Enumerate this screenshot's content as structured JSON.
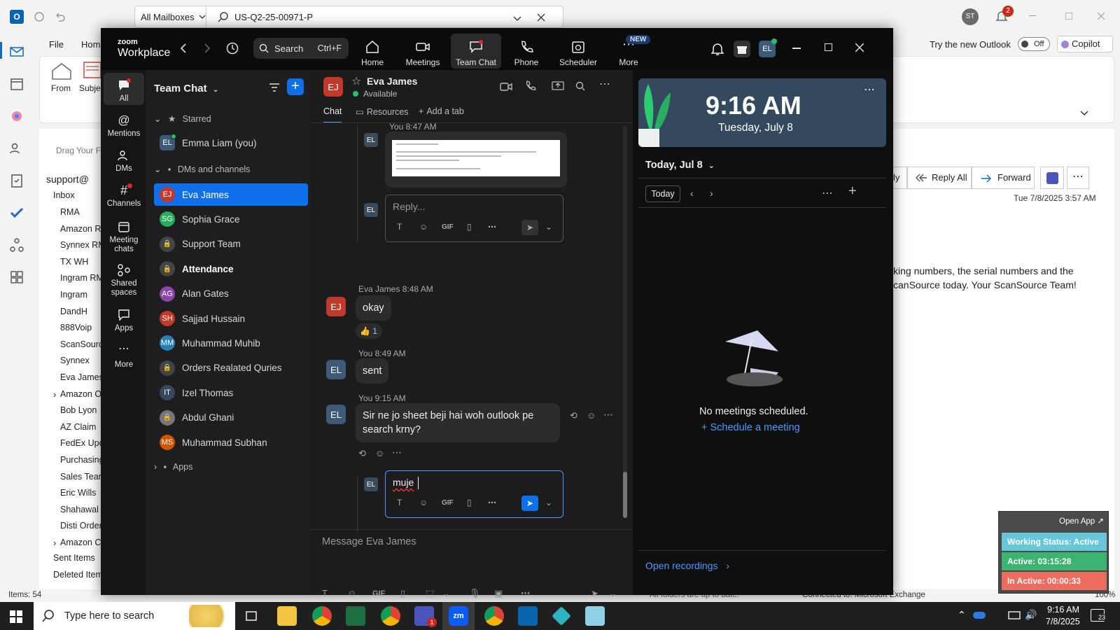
{
  "outlook": {
    "mailbox_scope": "All Mailboxes",
    "search_query": "US-Q2-25-00971-P",
    "menus": [
      "File",
      "Hom"
    ],
    "try_new": "Try the new Outlook",
    "toggle": "Off",
    "copilot": "Copilot",
    "profile_initials": "ST",
    "notif_count": "2",
    "ribbon": {
      "from": "From",
      "subject": "Subje"
    },
    "drag_text": "Drag Your Fa",
    "account": "support@",
    "inbox": "Inbox",
    "folders": [
      "RMA",
      "Amazon Re",
      "Synnex RM",
      "TX WH",
      "Ingram RM",
      "Ingram",
      "DandH",
      "888Voip",
      "ScanSource",
      "Synnex",
      "Eva James",
      "Amazon O",
      "Bob Lyon",
      "AZ Claim",
      "FedEx Upd",
      "Purchasing",
      "Sales Team",
      "Eric Wills",
      "Shahawal A",
      "Disti Order",
      "Amazon C"
    ],
    "sent": "Sent Items",
    "deleted": "Deleted Item",
    "actions": {
      "reply": "ly",
      "reply_all": "Reply All",
      "forward": "Forward"
    },
    "date": "Tue 7/8/2025 3:57 AM",
    "body_line1": "king numbers, the serial numbers and the",
    "body_line2": "canSource today. Your ScanSource Team!",
    "status_items": "Items: 54",
    "status_mid": "All folders are up to date.",
    "status_conn": "Connected to: Microsoft Exchange",
    "zoom_pct": "100%"
  },
  "zoom": {
    "brand_top": "zoom",
    "brand": "Workplace",
    "search": "Search",
    "shortcut": "Ctrl+F",
    "tabs": [
      {
        "label": "Home"
      },
      {
        "label": "Meetings"
      },
      {
        "label": "Team Chat"
      },
      {
        "label": "Phone"
      },
      {
        "label": "Scheduler"
      },
      {
        "label": "More",
        "badge": "NEW"
      }
    ],
    "user_initials": "EL",
    "left_nav": [
      "All",
      "Mentions",
      "DMs",
      "Channels",
      "Meeting chats",
      "Shared spaces",
      "Apps",
      "More"
    ],
    "list_title": "Team Chat",
    "starred": "Starred",
    "self": {
      "initials": "EL",
      "name": "Emma Liam (you)"
    },
    "dm_header": "DMs and channels",
    "contacts": [
      {
        "initials": "EJ",
        "name": "Eva James",
        "color": "#c0392b"
      },
      {
        "initials": "SG",
        "name": "Sophia Grace",
        "color": "#27ae60"
      },
      {
        "initials": "",
        "name": "Support Team",
        "color": "#444"
      },
      {
        "initials": "",
        "name": "Attendance",
        "color": "#444"
      },
      {
        "initials": "AG",
        "name": "Alan Gates",
        "color": "#8e44ad"
      },
      {
        "initials": "SH",
        "name": "Sajjad Hussain",
        "color": "#c0392b"
      },
      {
        "initials": "MM",
        "name": "Muhammad Muhib",
        "color": "#2980b9"
      },
      {
        "initials": "",
        "name": "Orders Realated Quries",
        "color": "#444"
      },
      {
        "initials": "IT",
        "name": "Izel Thomas",
        "color": "#34495e"
      },
      {
        "initials": "",
        "name": "Abdul Ghani",
        "color": "#777"
      },
      {
        "initials": "MS",
        "name": "Muhammad Subhan",
        "color": "#d35400"
      }
    ],
    "apps_section": "Apps",
    "chat": {
      "contact_initials": "EJ",
      "contact_name": "Eva James",
      "status": "Available",
      "tab_chat": "Chat",
      "tab_resources": "Resources",
      "tab_add": "Add a tab",
      "msg0_meta": "You 8:47 AM",
      "reply_placeholder": "Reply...",
      "msg1_meta": "Eva James 8:48 AM",
      "msg1_text": "okay",
      "reaction": "1",
      "msg2_meta": "You 8:49 AM",
      "msg2_text": "sent",
      "msg3_meta": "You 9:15 AM",
      "msg3_text": "Sir ne jo sheet beji hai woh outlook pe search krny?",
      "draft_text": "muje",
      "composer_placeholder": "Message Eva James"
    },
    "calendar": {
      "time": "9:16 AM",
      "date": "Tuesday, July 8",
      "today_label": "Today, Jul 8",
      "today_btn": "Today",
      "empty": "No meetings scheduled.",
      "schedule": "Schedule a meeting",
      "recordings": "Open recordings"
    }
  },
  "widget": {
    "open_app": "Open App ↗",
    "working": "Working Status: Active",
    "active": "Active: 03:15:28",
    "inactive": "In Active: 00:00:33"
  },
  "taskbar": {
    "search": "Type here to search",
    "time": "9:16 AM",
    "date": "7/8/2025",
    "notif": "23",
    "teams_badge": "1"
  }
}
